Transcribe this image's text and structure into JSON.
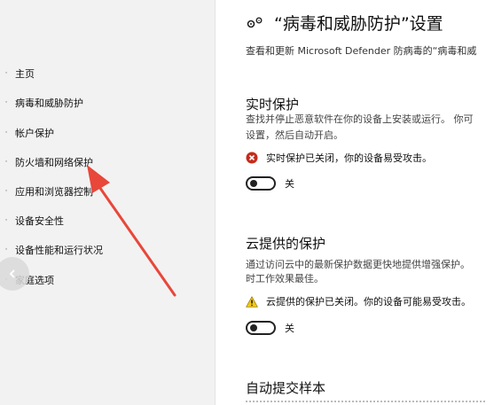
{
  "sidebar": {
    "back_tab": "ε",
    "items": [
      {
        "label": "主页",
        "icon": "home-icon"
      },
      {
        "label": "病毒和威胁防护",
        "icon": "shield-icon"
      },
      {
        "label": "帐户保护",
        "icon": "person-icon"
      },
      {
        "label": "防火墙和网络保护",
        "icon": "wifi-icon"
      },
      {
        "label": "应用和浏览器控制",
        "icon": "app-browser-icon"
      },
      {
        "label": "设备安全性",
        "icon": "laptop-icon"
      },
      {
        "label": "设备性能和运行状况",
        "icon": "heart-icon"
      },
      {
        "label": "家庭选项",
        "icon": "family-icon"
      }
    ]
  },
  "page": {
    "title": "“病毒和威胁防护”设置",
    "subtitle": "查看和更新 Microsoft Defender 防病毒的“病毒和威",
    "title_icon": "gears-icon"
  },
  "sections": {
    "realtime": {
      "heading": "实时保护",
      "desc_line1": "查找并停止恶意软件在你的设备上安装或运行。 你可",
      "desc_line2": "设置，然后自动开启。",
      "status": "实时保护已关闭，你的设备易受攻击。",
      "toggle_label": "关",
      "toggle_on": false
    },
    "cloud": {
      "heading": "云提供的保护",
      "desc_line1": "通过访问云中的最新保护数据更快地提供增强保护。",
      "desc_line2": "时工作效果最佳。",
      "status": "云提供的保护已关闭。你的设备可能易受攻击。",
      "toggle_label": "关",
      "toggle_on": false
    },
    "sample": {
      "heading": "自动提交样本"
    }
  },
  "colors": {
    "sidebar_bg": "#f2f2f2",
    "error_red": "#c42b1c",
    "warning_yellow": "#f2c811",
    "annotation_arrow": "#e8473a"
  }
}
